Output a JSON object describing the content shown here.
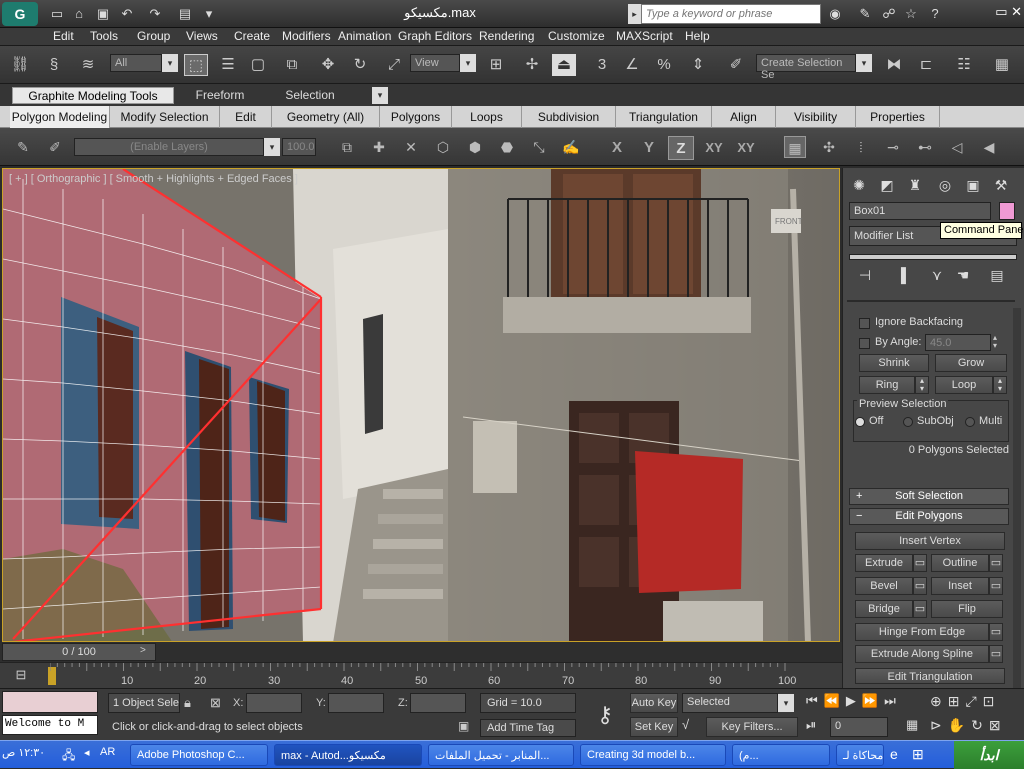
{
  "app": {
    "logo": "G",
    "doc_title": "مكسيكو.max"
  },
  "search": {
    "placeholder": "Type a keyword or phrase"
  },
  "menu": [
    "Edit",
    "Tools",
    "Group",
    "Views",
    "Create",
    "Modifiers",
    "Animation",
    "Graph Editors",
    "Rendering",
    "Customize",
    "MAXScript",
    "Help"
  ],
  "toolbar": {
    "selection_filter": "All",
    "ref_coord": "View",
    "named_selection": "Create Selection Se",
    "snap_value": "3"
  },
  "ribbon": {
    "tabs": [
      "Graphite Modeling Tools",
      "Freeform",
      "Selection"
    ],
    "groups": [
      "Polygon Modeling",
      "Modify Selection",
      "Edit",
      "Geometry (All)",
      "Polygons",
      "Loops",
      "Subdivision",
      "Triangulation",
      "Align",
      "Visibility",
      "Properties"
    ],
    "layers_placeholder": "(Enable Layers)",
    "value": "100.0",
    "axes": [
      "X",
      "Y",
      "Z",
      "XY",
      "XY"
    ]
  },
  "viewport": {
    "label": "[ + ] [ Orthographic ] [ Smooth + Highlights + Edged Faces ]"
  },
  "command_panel": {
    "tooltip": "Command Panel",
    "object_name": "Box01",
    "modifier_list": "Modifier List",
    "ignore_backfacing": "Ignore Backfacing",
    "by_angle": "By Angle:",
    "angle_value": "45.0",
    "shrink": "Shrink",
    "grow": "Grow",
    "ring": "Ring",
    "loop": "Loop",
    "preview_selection": "Preview Selection",
    "preview_off": "Off",
    "preview_subobj": "SubObj",
    "preview_multi": "Multi",
    "polygons_selected": "0 Polygons Selected",
    "soft_selection": "Soft Selection",
    "edit_polygons": "Edit Polygons",
    "insert_vertex": "Insert Vertex",
    "extrude": "Extrude",
    "outline": "Outline",
    "bevel": "Bevel",
    "inset": "Inset",
    "bridge": "Bridge",
    "flip": "Flip",
    "hinge_from_edge": "Hinge From Edge",
    "extrude_along_spline": "Extrude Along Spline",
    "edit_triangulation": "Edit Triangulation",
    "plus": "+",
    "minus": "−"
  },
  "timeline": {
    "frame": "0 / 100",
    "ticks": [
      "10",
      "20",
      "30",
      "40",
      "50",
      "60",
      "70",
      "80",
      "90",
      "100"
    ]
  },
  "status": {
    "welcome": "Welcome to M",
    "objects_selected": "1 Object Sele",
    "x_label": "X:",
    "y_label": "Y:",
    "z_label": "Z:",
    "grid": "Grid = 10.0",
    "prompt": "Click or click-and-drag to select objects",
    "add_time_tag": "Add Time Tag",
    "auto_key": "Auto Key",
    "set_key": "Set Key",
    "selected": "Selected",
    "key_filters": "Key Filters...",
    "frame_value": "0"
  },
  "taskbar": {
    "start": "ابدأ",
    "clock": "١٢:٣٠ ص",
    "lang": "AR",
    "items": [
      "Adobe Photoshop C...",
      "max - Autod...مكسيكو",
      "المنابر - تحميل الملفات...",
      "Creating 3d model b...",
      "(م...",
      "محاكاة لـ..."
    ]
  },
  "colors": {
    "viewport_border": "#c9a227",
    "selection_face": "#b34a5a",
    "swatch": "#f09ad4"
  }
}
